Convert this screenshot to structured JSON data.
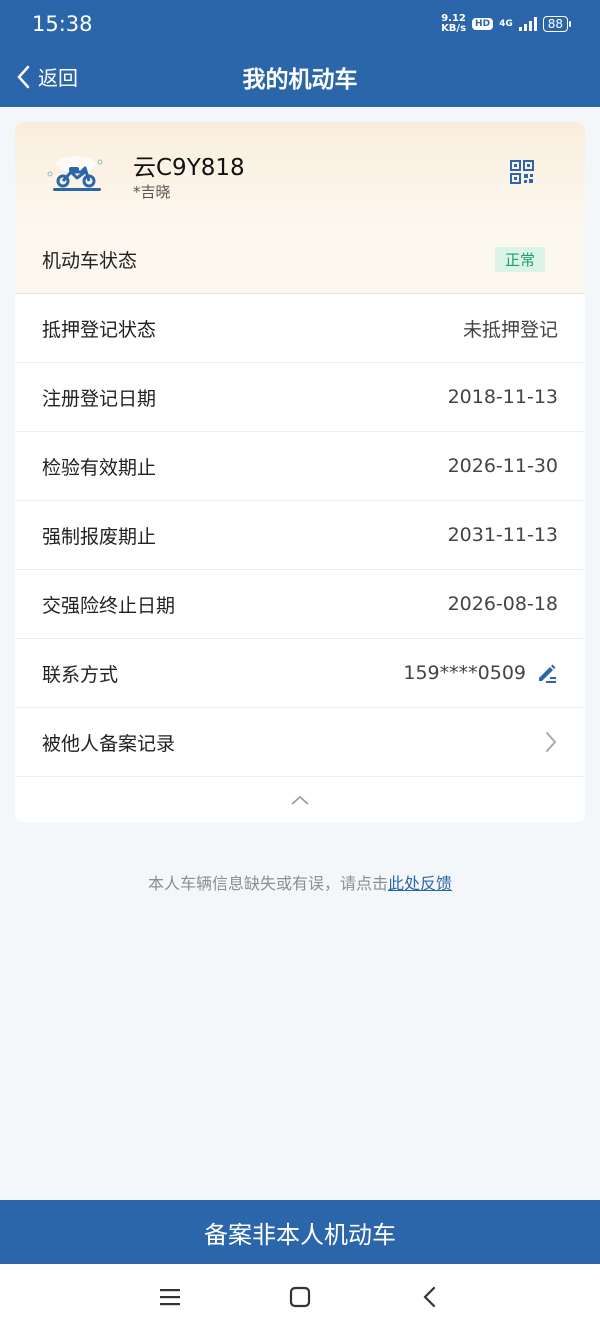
{
  "status_bar": {
    "time": "15:38",
    "speed_value": "9.12",
    "speed_unit": "KB/s",
    "hd": "HD",
    "network": "4G",
    "battery": "88"
  },
  "nav": {
    "back_label": "返回",
    "title": "我的机动车"
  },
  "vehicle": {
    "plate": "云C9Y818",
    "owner": "*吉晓",
    "icon": "motorcycle-icon"
  },
  "rows": [
    {
      "label": "机动车状态",
      "value": "正常"
    },
    {
      "label": "抵押登记状态",
      "value": "未抵押登记"
    },
    {
      "label": "注册登记日期",
      "value": "2018-11-13"
    },
    {
      "label": "检验有效期止",
      "value": "2026-11-30"
    },
    {
      "label": "强制报废期止",
      "value": "2031-11-13"
    },
    {
      "label": "交强险终止日期",
      "value": "2026-08-18"
    },
    {
      "label": "联系方式",
      "value": "159****0509"
    },
    {
      "label": "被他人备案记录",
      "value": ""
    }
  ],
  "feedback": {
    "text": "本人车辆信息缺失或有误，请点击",
    "link": "此处反馈"
  },
  "bottom_button": "备案非本人机动车",
  "colors": {
    "primary": "#2b66aa",
    "status_ok": "#1aa065",
    "status_ok_bg": "#dcf3e9"
  }
}
